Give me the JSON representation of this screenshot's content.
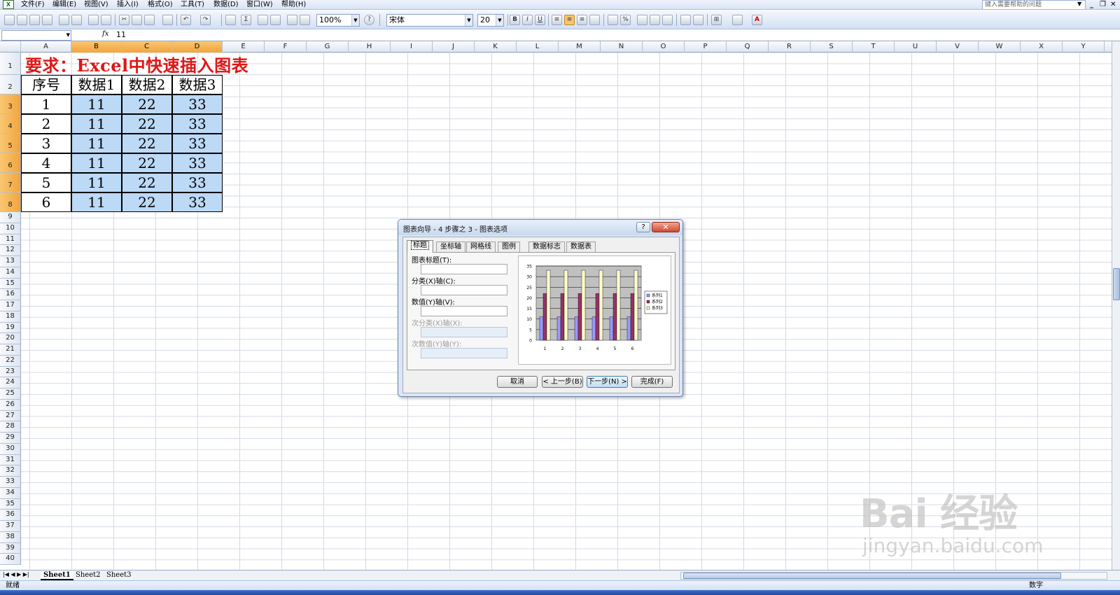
{
  "app": {
    "icon": "excel-app-icon"
  },
  "menu": [
    "文件(F)",
    "编辑(E)",
    "视图(V)",
    "插入(I)",
    "格式(O)",
    "工具(T)",
    "数据(D)",
    "窗口(W)",
    "帮助(H)"
  ],
  "help_box": {
    "placeholder": "键入需要帮助的问题"
  },
  "toolbar": {
    "zoom": "100%",
    "font": "宋体",
    "size": "20",
    "bold": "B",
    "italic": "I",
    "underline": "U",
    "percent": "%"
  },
  "formula_bar": {
    "name_box": "",
    "fx": "fx",
    "value": "11"
  },
  "columns": [
    "A",
    "B",
    "C",
    "D",
    "E",
    "F",
    "G",
    "H",
    "I",
    "J",
    "K",
    "L",
    "M",
    "N",
    "O",
    "P",
    "Q",
    "R",
    "S",
    "T",
    "U",
    "V",
    "W",
    "X",
    "Y"
  ],
  "rows": [
    "1",
    "2",
    "3",
    "4",
    "5",
    "6",
    "7",
    "8",
    "9",
    "10",
    "11",
    "12",
    "13",
    "14",
    "15",
    "16",
    "17",
    "18",
    "19",
    "20",
    "21",
    "22",
    "23",
    "24",
    "25",
    "26",
    "27",
    "28",
    "29",
    "30",
    "31",
    "32",
    "33",
    "34",
    "35",
    "36",
    "37",
    "38",
    "39",
    "40"
  ],
  "sheet": {
    "title": "要求：Excel中快速插入图表",
    "headers": [
      "序号",
      "数据1",
      "数据2",
      "数据3"
    ],
    "data": [
      [
        "1",
        "11",
        "22",
        "33"
      ],
      [
        "2",
        "11",
        "22",
        "33"
      ],
      [
        "3",
        "11",
        "22",
        "33"
      ],
      [
        "4",
        "11",
        "22",
        "33"
      ],
      [
        "5",
        "11",
        "22",
        "33"
      ],
      [
        "6",
        "11",
        "22",
        "33"
      ]
    ]
  },
  "sheet_tabs": [
    "Sheet1",
    "Sheet2",
    "Sheet3"
  ],
  "status": {
    "left": "就绪",
    "right": "数字"
  },
  "dialog": {
    "title": "图表向导 - 4 步骤之 3 - 图表选项",
    "help": "?",
    "close": "✕",
    "tabs": [
      "标题",
      "坐标轴",
      "网格线",
      "图例",
      "数据标志",
      "数据表"
    ],
    "fields": [
      "图表标题(T):",
      "分类(X)轴(C):",
      "数值(Y)轴(V):",
      "次分类(X)轴(X):",
      "次数值(Y)轴(Y):"
    ],
    "buttons": {
      "cancel": "取消",
      "back": "< 上一步(B)",
      "next": "下一步(N) >",
      "finish": "完成(F)"
    }
  },
  "chart_data": {
    "type": "bar",
    "categories": [
      "1",
      "2",
      "3",
      "4",
      "5",
      "6"
    ],
    "series": [
      {
        "name": "系列1",
        "values": [
          11,
          11,
          11,
          11,
          11,
          11
        ],
        "color": "#9999ff"
      },
      {
        "name": "系列2",
        "values": [
          22,
          22,
          22,
          22,
          22,
          22
        ],
        "color": "#993366"
      },
      {
        "name": "系列3",
        "values": [
          33,
          33,
          33,
          33,
          33,
          33
        ],
        "color": "#ffffcc"
      }
    ],
    "yticks": [
      "0",
      "5",
      "10",
      "15",
      "20",
      "25",
      "30",
      "35"
    ],
    "ylim": [
      0,
      35
    ],
    "plot_bg": "#c0c0c0",
    "legend": "right"
  },
  "watermark": {
    "line1": "Bai 经验",
    "line2": "jingyan.baidu.com"
  }
}
